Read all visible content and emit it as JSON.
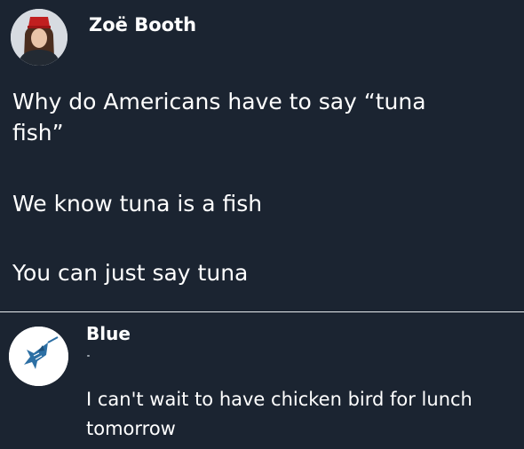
{
  "post": {
    "author": "Zoë Booth",
    "lines": [
      "Why do Americans have to say “tuna",
      "fish”",
      "We know tuna is a fish",
      "You can just say tuna"
    ]
  },
  "reply": {
    "author": "Blue",
    "lines": [
      "I can't wait to have chicken bird for lunch",
      "tomorrow"
    ]
  }
}
